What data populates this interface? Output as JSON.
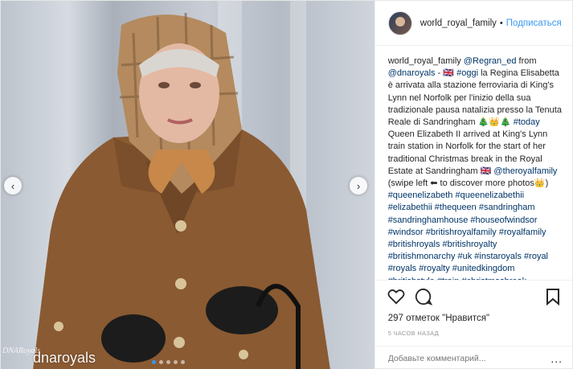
{
  "header": {
    "username": "world_royal_family",
    "separator": "•",
    "follow_label": "Подписаться"
  },
  "caption": {
    "user": "world_royal_family",
    "mention_regran": "@Regran_ed",
    "from_word": " from",
    "mention_dnaroyals": "@dnaroyals",
    "text_it": " - 🇬🇧 ",
    "hashtag_oggi": "#oggi",
    "text_it2": " la Regina Elisabetta è arrivata alla stazione ferroviaria di King's Lynn nel Norfolk per l'inizio della sua tradizionale pausa natalizia presso la Tenuta Reale di Sandringham 🎄👑🎄",
    "hashtag_today": "#today",
    "text_en": " Queen Elizabeth II arrived at King's Lynn train station in Norfolk for the start of her traditional Christmas break in the Royal Estate at Sandringham 🇬🇧 ",
    "mention_theroyalfamily": "@theroyalfamily",
    "text_swipe": " (swipe left ⬅ to discover more photos👑)",
    "hashtags": "#queenelizabeth #queenelizabethii #elizabethii #thequeen #sandringham #sandringhamhouse #houseofwindsor #windsor #britishroyalfamily #royalfamily #britishroyals #britishroyalty #britishmonarchy #uk #instaroyals #royal #royals #royalty #unitedkingdom #britishstyle #train #christmasbreak #royalchristmas #christmastradition #britishtradition #britishtradition"
  },
  "actions": {
    "like_icon": "heart-icon",
    "comment_icon": "comment-icon",
    "save_icon": "bookmark-icon"
  },
  "likes_text": "297 отметок \"Нравится\"",
  "timestamp": "5 ЧАСОВ НАЗАД",
  "comment_box": {
    "placeholder": "Добавьте комментарий...",
    "more_label": "..."
  },
  "media": {
    "watermark_logo": "DNARoyals",
    "watermark_text": "dnaroyals",
    "carousel_dots": 5,
    "active_dot": 0
  }
}
